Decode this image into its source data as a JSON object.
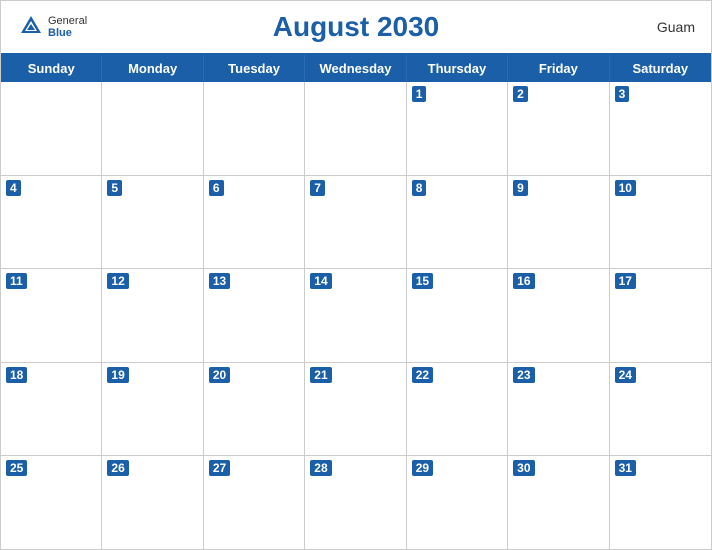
{
  "header": {
    "title": "August 2030",
    "location": "Guam",
    "logo": {
      "general": "General",
      "blue": "Blue"
    }
  },
  "days_of_week": [
    "Sunday",
    "Monday",
    "Tuesday",
    "Wednesday",
    "Thursday",
    "Friday",
    "Saturday"
  ],
  "weeks": [
    [
      {
        "date": null,
        "empty": true
      },
      {
        "date": null,
        "empty": true
      },
      {
        "date": null,
        "empty": true
      },
      {
        "date": null,
        "empty": true
      },
      {
        "date": "1",
        "empty": false
      },
      {
        "date": "2",
        "empty": false
      },
      {
        "date": "3",
        "empty": false
      }
    ],
    [
      {
        "date": "4",
        "empty": false
      },
      {
        "date": "5",
        "empty": false
      },
      {
        "date": "6",
        "empty": false
      },
      {
        "date": "7",
        "empty": false
      },
      {
        "date": "8",
        "empty": false
      },
      {
        "date": "9",
        "empty": false
      },
      {
        "date": "10",
        "empty": false
      }
    ],
    [
      {
        "date": "11",
        "empty": false
      },
      {
        "date": "12",
        "empty": false
      },
      {
        "date": "13",
        "empty": false
      },
      {
        "date": "14",
        "empty": false
      },
      {
        "date": "15",
        "empty": false
      },
      {
        "date": "16",
        "empty": false
      },
      {
        "date": "17",
        "empty": false
      }
    ],
    [
      {
        "date": "18",
        "empty": false
      },
      {
        "date": "19",
        "empty": false
      },
      {
        "date": "20",
        "empty": false
      },
      {
        "date": "21",
        "empty": false
      },
      {
        "date": "22",
        "empty": false
      },
      {
        "date": "23",
        "empty": false
      },
      {
        "date": "24",
        "empty": false
      }
    ],
    [
      {
        "date": "25",
        "empty": false
      },
      {
        "date": "26",
        "empty": false
      },
      {
        "date": "27",
        "empty": false
      },
      {
        "date": "28",
        "empty": false
      },
      {
        "date": "29",
        "empty": false
      },
      {
        "date": "30",
        "empty": false
      },
      {
        "date": "31",
        "empty": false
      }
    ]
  ]
}
